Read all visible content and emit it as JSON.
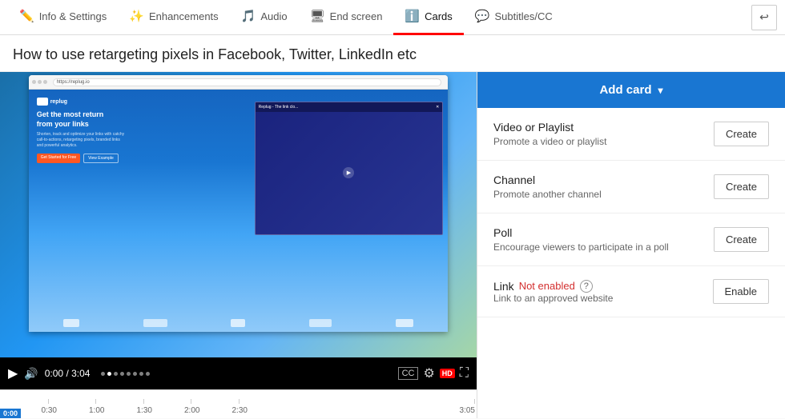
{
  "nav": {
    "items": [
      {
        "id": "info-settings",
        "label": "Info & Settings",
        "icon": "✏️",
        "active": false
      },
      {
        "id": "enhancements",
        "label": "Enhancements",
        "icon": "✨",
        "active": false
      },
      {
        "id": "audio",
        "label": "Audio",
        "icon": "🎵",
        "active": false
      },
      {
        "id": "end-screen",
        "label": "End screen",
        "icon": "🖥",
        "active": false
      },
      {
        "id": "cards",
        "label": "Cards",
        "icon": "ℹ️",
        "active": true
      },
      {
        "id": "subtitles",
        "label": "Subtitles/CC",
        "icon": "💬",
        "active": false
      }
    ],
    "back_icon": "↩"
  },
  "page": {
    "title": "How to use retargeting pixels in Facebook, Twitter, LinkedIn etc"
  },
  "browser": {
    "url": "https://replug.io",
    "headline": "Get the most return from your links",
    "subtext": "Shorten, track and optimize your links with catchy call-to-actions, retargeting pixels, branded links and powerful analytics.",
    "cta": "Get Started for Free",
    "cta2": "View Example",
    "logo": "replug"
  },
  "video_controls": {
    "play_icon": "▶",
    "volume_icon": "🔊",
    "time": "0:00 / 3:04",
    "cc_label": "CC",
    "fullscreen_icon": "⛶"
  },
  "timeline": {
    "current_label": "0:00",
    "markers": [
      "0:30",
      "1:00",
      "1:30",
      "2:00",
      "2:30",
      "3:05"
    ],
    "start_badge": "0:00"
  },
  "right_panel": {
    "add_card_label": "Add card",
    "dropdown_arrow": "▾",
    "options": [
      {
        "id": "video-playlist",
        "title": "Video or Playlist",
        "description": "Promote a video or playlist",
        "action": "Create"
      },
      {
        "id": "channel",
        "title": "Channel",
        "description": "Promote another channel",
        "action": "Create"
      },
      {
        "id": "poll",
        "title": "Poll",
        "description": "Encourage viewers to participate in a poll",
        "action": "Create"
      }
    ],
    "link": {
      "title": "Link",
      "status": "Not enabled",
      "description": "Link to an approved website",
      "action": "Enable",
      "help": "?"
    }
  }
}
